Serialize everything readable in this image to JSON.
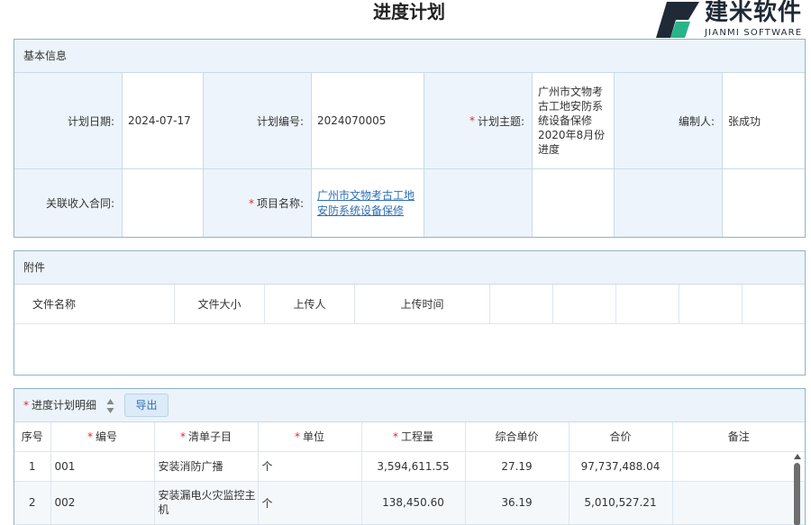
{
  "page": {
    "title": "进度计划"
  },
  "logo": {
    "cn": "建米软件",
    "en": "JIANMI SOFTWARE"
  },
  "basic": {
    "header": "基本信息",
    "plan_date_label": "计划日期:",
    "plan_date": "2024-07-17",
    "plan_no_label": "计划编号:",
    "plan_no": "2024070005",
    "plan_subject_label": "计划主题:",
    "plan_subject": "广州市文物考古工地安防系统设备保修2020年8月份进度",
    "editor_label": "编制人:",
    "editor": "张成功",
    "contract_label": "关联收入合同:",
    "contract": "",
    "project_label": "项目名称:",
    "project": "广州市文物考古工地安防系统设备保修"
  },
  "attachment": {
    "header": "附件",
    "columns": [
      "文件名称",
      "文件大小",
      "上传人",
      "上传时间"
    ]
  },
  "detail": {
    "title": "进度计划明细",
    "export_label": "导出",
    "columns": {
      "seq": "序号",
      "code": "编号",
      "item": "清单子目",
      "unit": "单位",
      "qty": "工程量",
      "price": "综合单价",
      "total": "合价",
      "remark": "备注"
    },
    "rows": [
      {
        "seq": "1",
        "code": "001",
        "item": "安装消防广播",
        "unit": "个",
        "qty": "3,594,611.55",
        "price": "27.19",
        "total": "97,737,488.04",
        "remark": ""
      },
      {
        "seq": "2",
        "code": "002",
        "item": "安装漏电火灾监控主机",
        "unit": "个",
        "qty": "138,450.60",
        "price": "36.19",
        "total": "5,010,527.21",
        "remark": ""
      }
    ]
  },
  "colors": {
    "border": "#8fb3c9",
    "header_bg": "#ecf3fa",
    "label_bg": "#edf4fb",
    "link": "#2f6fb2",
    "required": "#e0292f"
  }
}
